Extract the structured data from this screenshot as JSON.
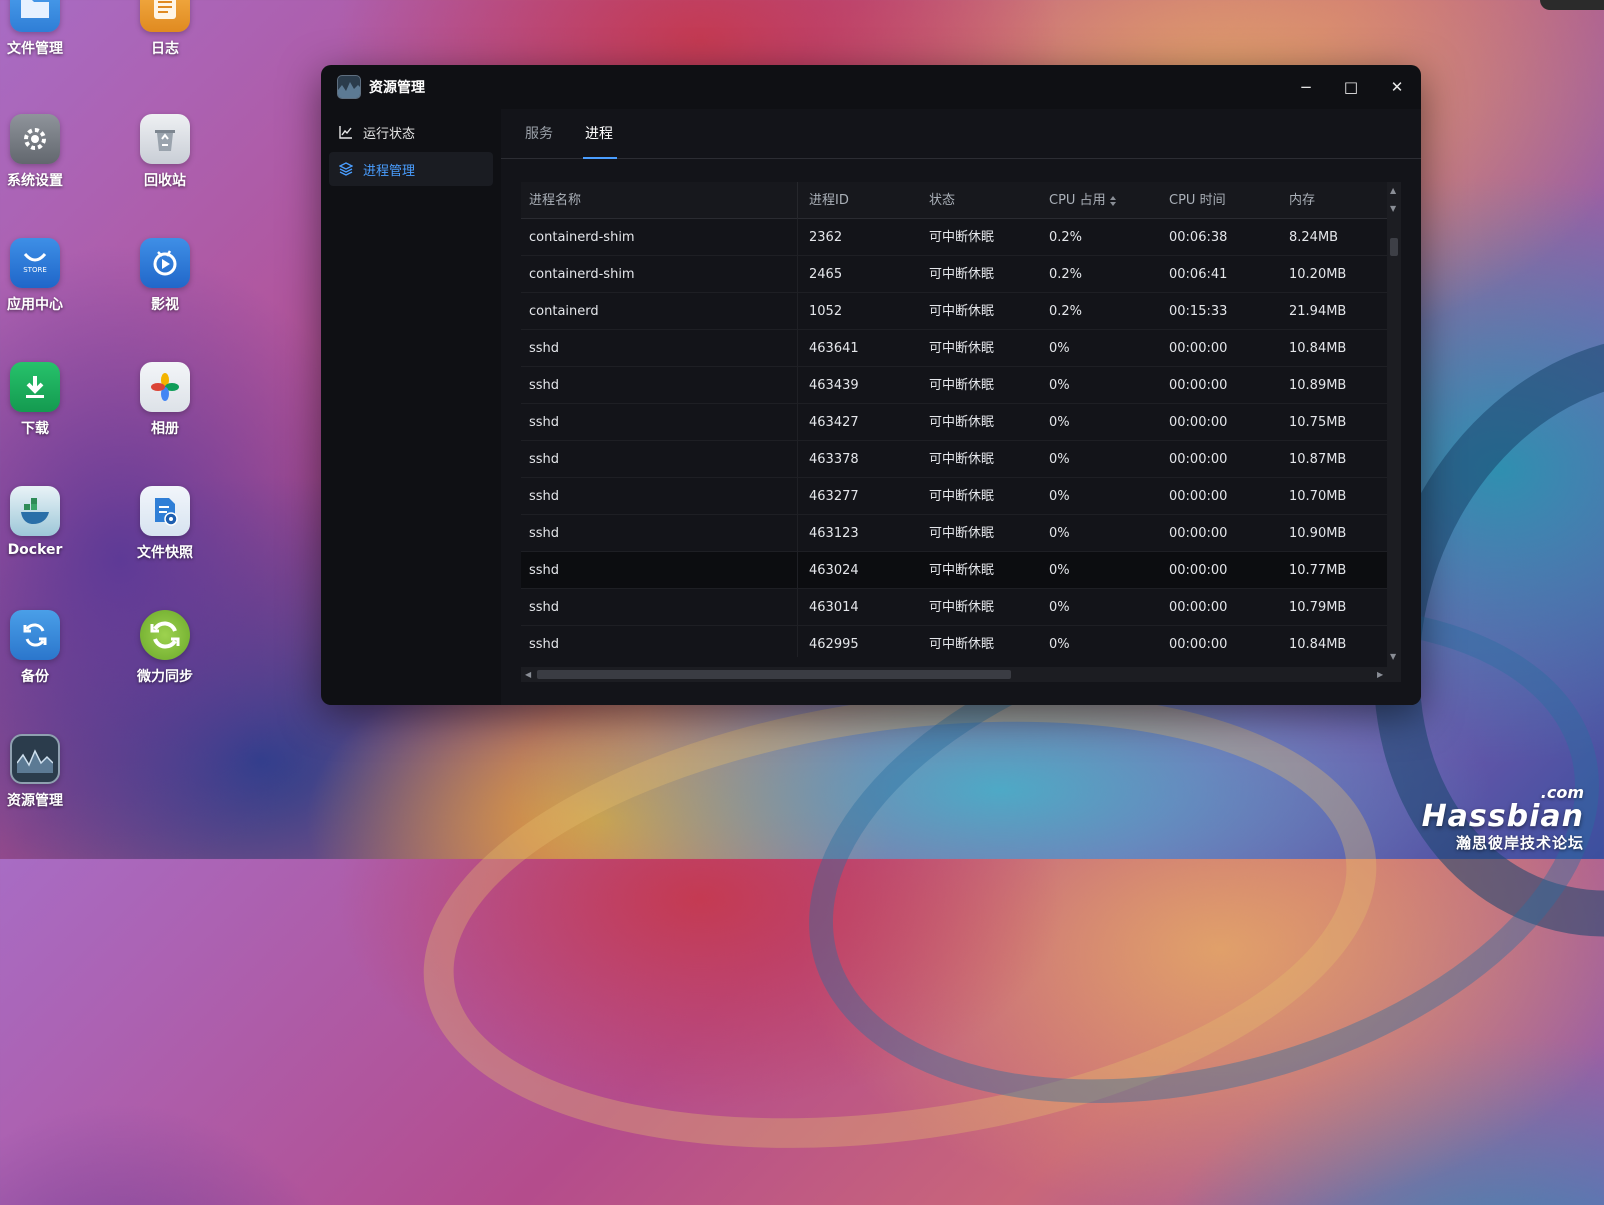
{
  "desktop": {
    "icons": [
      {
        "label": "文件管理",
        "icon": "folder-icon"
      },
      {
        "label": "日志",
        "icon": "log-icon"
      },
      {
        "label": "系统设置",
        "icon": "gear-icon"
      },
      {
        "label": "回收站",
        "icon": "recycle-bin-icon"
      },
      {
        "label": "应用中心",
        "icon": "store-icon",
        "badge": "STORE"
      },
      {
        "label": "影视",
        "icon": "video-icon"
      },
      {
        "label": "下载",
        "icon": "download-icon"
      },
      {
        "label": "相册",
        "icon": "photos-icon"
      },
      {
        "label": "Docker",
        "icon": "docker-icon"
      },
      {
        "label": "文件快照",
        "icon": "file-snapshot-icon"
      },
      {
        "label": "备份",
        "icon": "backup-icon"
      },
      {
        "label": "微力同步",
        "icon": "sync-icon"
      },
      {
        "label": "资源管理",
        "icon": "resource-monitor-icon"
      }
    ]
  },
  "window": {
    "title": "资源管理",
    "controls": {
      "minimize": "−",
      "maximize": "□",
      "close": "✕"
    }
  },
  "sidebar": {
    "items": [
      {
        "label": "运行状态",
        "icon": "line-chart-icon",
        "active": false
      },
      {
        "label": "进程管理",
        "icon": "layers-icon",
        "active": true
      }
    ]
  },
  "tabs": [
    {
      "label": "服务",
      "active": false
    },
    {
      "label": "进程",
      "active": true
    }
  ],
  "table": {
    "columns": [
      "进程名称",
      "进程ID",
      "状态",
      "CPU 占用",
      "CPU 时间",
      "内存"
    ],
    "rows": [
      {
        "name": "containerd-shim",
        "pid": "2362",
        "status": "可中断休眠",
        "cpu": "0.2%",
        "cpu_time": "00:06:38",
        "mem": "8.24MB"
      },
      {
        "name": "containerd-shim",
        "pid": "2465",
        "status": "可中断休眠",
        "cpu": "0.2%",
        "cpu_time": "00:06:41",
        "mem": "10.20MB"
      },
      {
        "name": "containerd",
        "pid": "1052",
        "status": "可中断休眠",
        "cpu": "0.2%",
        "cpu_time": "00:15:33",
        "mem": "21.94MB"
      },
      {
        "name": "sshd",
        "pid": "463641",
        "status": "可中断休眠",
        "cpu": "0%",
        "cpu_time": "00:00:00",
        "mem": "10.84MB"
      },
      {
        "name": "sshd",
        "pid": "463439",
        "status": "可中断休眠",
        "cpu": "0%",
        "cpu_time": "00:00:00",
        "mem": "10.89MB"
      },
      {
        "name": "sshd",
        "pid": "463427",
        "status": "可中断休眠",
        "cpu": "0%",
        "cpu_time": "00:00:00",
        "mem": "10.75MB"
      },
      {
        "name": "sshd",
        "pid": "463378",
        "status": "可中断休眠",
        "cpu": "0%",
        "cpu_time": "00:00:00",
        "mem": "10.87MB"
      },
      {
        "name": "sshd",
        "pid": "463277",
        "status": "可中断休眠",
        "cpu": "0%",
        "cpu_time": "00:00:00",
        "mem": "10.70MB"
      },
      {
        "name": "sshd",
        "pid": "463123",
        "status": "可中断休眠",
        "cpu": "0%",
        "cpu_time": "00:00:00",
        "mem": "10.90MB"
      },
      {
        "name": "sshd",
        "pid": "463024",
        "status": "可中断休眠",
        "cpu": "0%",
        "cpu_time": "00:00:00",
        "mem": "10.77MB"
      },
      {
        "name": "sshd",
        "pid": "463014",
        "status": "可中断休眠",
        "cpu": "0%",
        "cpu_time": "00:00:00",
        "mem": "10.79MB"
      },
      {
        "name": "sshd",
        "pid": "462995",
        "status": "可中断休眠",
        "cpu": "0%",
        "cpu_time": "00:00:00",
        "mem": "10.84MB"
      }
    ]
  },
  "watermark": {
    "com": ".com",
    "name": "Hassbian",
    "sub": "瀚思彼岸技术论坛"
  },
  "colors": {
    "accent": "#4a9eff",
    "window_bg": "#0f1014",
    "table_bg": "#131419"
  }
}
